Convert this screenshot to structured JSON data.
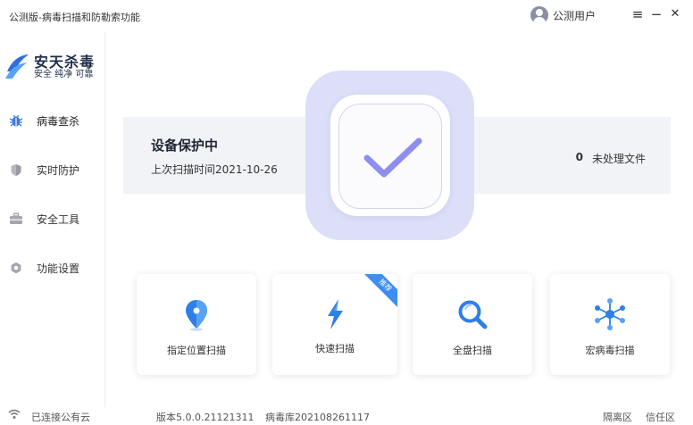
{
  "titlebar": {
    "title": "公测版-病毒扫描和防勒索功能",
    "user_name": "公测用户",
    "menu_glyph": "≡",
    "minimize_glyph": "−",
    "close_glyph": "✕"
  },
  "brand": {
    "name": "安天杀毒",
    "slogan": "安全 纯净 可靠"
  },
  "sidebar": {
    "items": [
      {
        "label": "病毒查杀",
        "icon": "bug-icon",
        "active": true
      },
      {
        "label": "实时防护",
        "icon": "shield-icon",
        "active": false
      },
      {
        "label": "安全工具",
        "icon": "toolbox-icon",
        "active": false
      },
      {
        "label": "功能设置",
        "icon": "settings-icon",
        "active": false
      }
    ]
  },
  "status": {
    "title": "设备保护中",
    "last_scan": "上次扫描时间2021-10-26",
    "pending_count": "0",
    "pending_label": "未处理文件"
  },
  "scan_options": [
    {
      "label": "指定位置扫描",
      "icon": "location-pin-icon"
    },
    {
      "label": "快速扫描",
      "icon": "lightning-icon",
      "badge": "推荐"
    },
    {
      "label": "全盘扫描",
      "icon": "magnifier-icon"
    },
    {
      "label": "宏病毒扫描",
      "icon": "molecule-icon"
    }
  ],
  "footer": {
    "cloud_status": "已连接公有云",
    "version": "版本5.0.0.21121311",
    "virus_db": "病毒库202108261117",
    "quarantine": "隔离区",
    "trust_zone": "信任区"
  },
  "colors": {
    "accent": "#3d8ef0",
    "check": "#8e8ef0",
    "badge_bg": "#dcdff7",
    "card_bg": "#f2f3f7",
    "sidebar_active_icon": "#3d7be8"
  }
}
